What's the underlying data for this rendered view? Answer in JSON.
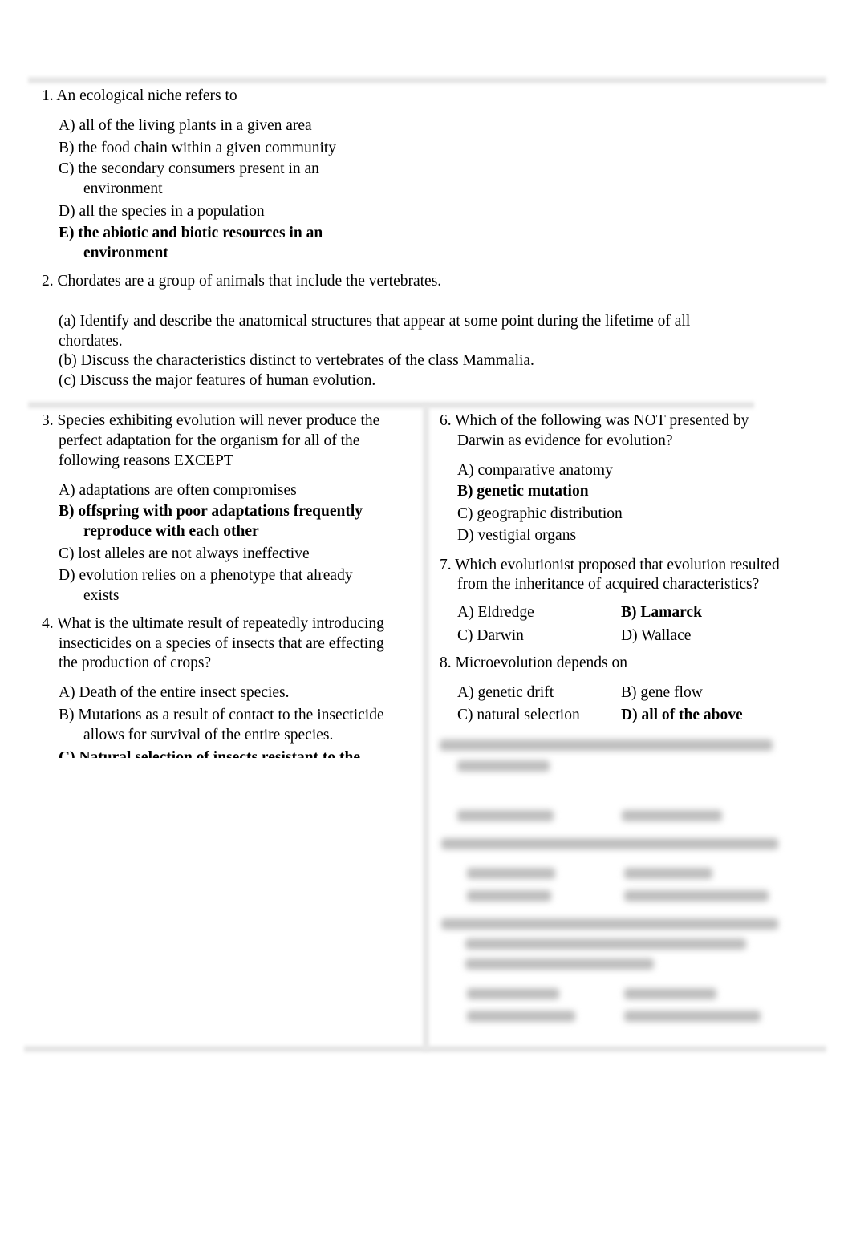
{
  "q1": {
    "stem": "1. An ecological niche refers to",
    "options": [
      "A) all of the living plants in a given area",
      "B) the food chain within a given community",
      "C) the secondary consumers present in an",
      "environment",
      "D) all the species in a population",
      "E) the abiotic and biotic resources in an",
      "environment"
    ]
  },
  "q2": {
    "stem": "2. Chordates are a group of animals that include the vertebrates.",
    "parts": [
      "(a) Identify and describe the anatomical structures that appear at some point during the lifetime of all",
      "chordates.",
      "(b) Discuss the characteristics distinct to vertebrates of the class Mammalia.",
      "(c) Discuss the major features of human evolution."
    ]
  },
  "q3": {
    "stem": [
      "3. Species exhibiting evolution will never produce the",
      "perfect adaptation for the organism for all of the",
      "following reasons EXCEPT"
    ],
    "options": [
      "A) adaptations are often compromises",
      "B) offspring with poor adaptations frequently",
      "reproduce with each other",
      "C) lost alleles are not always ineffective",
      "D) evolution relies on a phenotype that already",
      "exists"
    ]
  },
  "q4": {
    "stem": [
      "4. What is the ultimate result of repeatedly introducing",
      "insecticides on a species of insects that are effecting",
      "the production of crops?"
    ],
    "options": [
      "A) Death of the entire insect species.",
      "B) Mutations as a result of contact to the insecticide",
      "allows for survival of the entire species.",
      "C) Natural selection of insects resistant to the"
    ]
  },
  "q6": {
    "stem": [
      "6. Which of the following was NOT presented by",
      "Darwin as evidence for evolution?"
    ],
    "options": [
      "A)  comparative anatomy",
      "B)  genetic mutation",
      "C)  geographic distribution",
      "D)  vestigial organs"
    ]
  },
  "q7": {
    "stem": [
      "7. Which evolutionist proposed that evolution resulted",
      "from the inheritance of acquired characteristics?"
    ],
    "options": [
      "A)  Eldredge",
      "B)  Lamarck",
      "C)  Darwin",
      "D)  Wallace"
    ]
  },
  "q8": {
    "stem": "8. Microevolution depends on",
    "options": [
      "A)  genetic drift",
      "B)  gene flow",
      "C)  natural selection",
      "D)  all of the above"
    ]
  },
  "correct_answers": {
    "q1": "E",
    "q3": "B",
    "q6": "B",
    "q7": "B",
    "q8": "D"
  }
}
